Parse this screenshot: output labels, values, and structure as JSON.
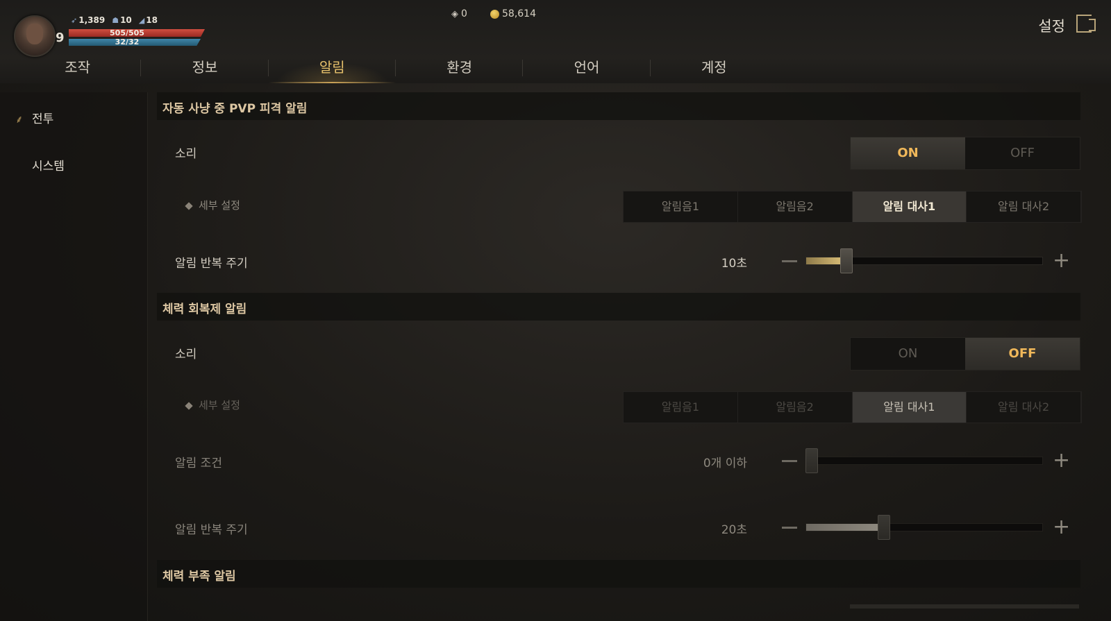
{
  "player": {
    "level": "9",
    "stat1": "1,389",
    "stat2": "10",
    "stat3": "18",
    "hp": "505/505",
    "mp": "32/32",
    "hp_fraction": 1.0,
    "mp_fraction": 1.0
  },
  "currency": {
    "gems": "0",
    "gold": "58,614"
  },
  "header": {
    "title": "설정",
    "exit_icon": "exit-icon"
  },
  "tabs": [
    {
      "label": "조작"
    },
    {
      "label": "정보"
    },
    {
      "label": "알림",
      "active": true
    },
    {
      "label": "환경"
    },
    {
      "label": "언어"
    },
    {
      "label": "계정"
    }
  ],
  "sidebar": {
    "items": [
      {
        "label": "전투",
        "active": true
      },
      {
        "label": "시스템"
      }
    ]
  },
  "sections": [
    {
      "title": "자동 사냥 중 PVP 피격 알림",
      "sound_label": "소리",
      "on_label": "ON",
      "off_label": "OFF",
      "sound_state": "ON",
      "detail_label": "세부 설정",
      "detail_options": [
        "알림음1",
        "알림음2",
        "알림 대사1",
        "알림 대사2"
      ],
      "detail_selected": "알림 대사1",
      "repeat_label": "알림 반복 주기",
      "repeat_value": "10초",
      "repeat_fraction": 0.17
    },
    {
      "title": "체력 회복제 알림",
      "sound_label": "소리",
      "on_label": "ON",
      "off_label": "OFF",
      "sound_state": "OFF",
      "detail_label": "세부 설정",
      "detail_options": [
        "알림음1",
        "알림음2",
        "알림 대사1",
        "알림 대사2"
      ],
      "detail_selected": "알림 대사1",
      "condition_label": "알림 조건",
      "condition_value": "0개 이하",
      "condition_fraction": 0.0,
      "repeat_label": "알림 반복 주기",
      "repeat_value": "20초",
      "repeat_fraction": 0.33
    },
    {
      "title": "체력 부족 알림"
    }
  ],
  "colors": {
    "accent_gold": "#e6c06b",
    "toggle_selected": "#f0b85a",
    "hp": "#d04e40",
    "mp": "#3f86a8"
  }
}
